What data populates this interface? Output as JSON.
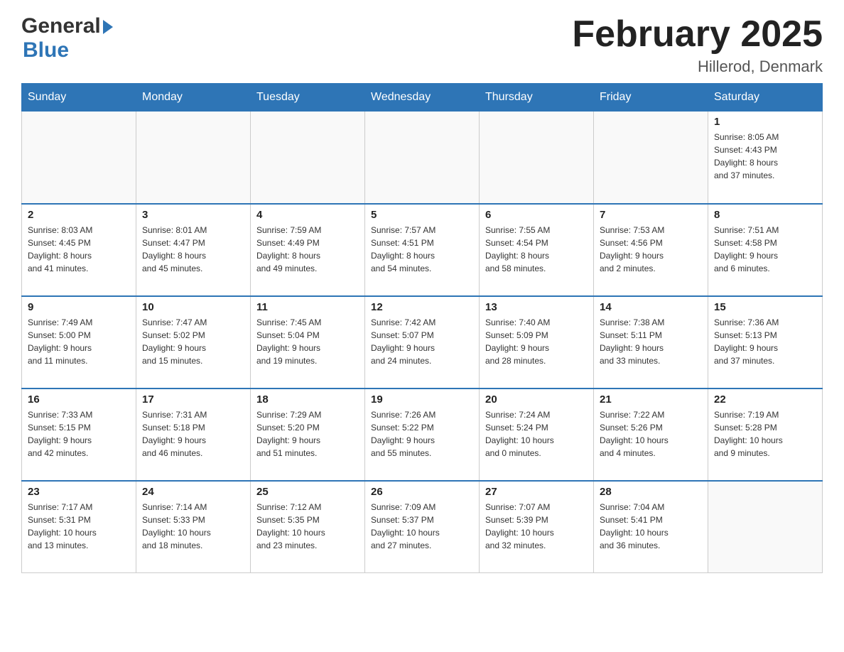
{
  "header": {
    "logo_general": "General",
    "logo_blue": "Blue",
    "title": "February 2025",
    "location": "Hillerod, Denmark"
  },
  "weekdays": [
    "Sunday",
    "Monday",
    "Tuesday",
    "Wednesday",
    "Thursday",
    "Friday",
    "Saturday"
  ],
  "weeks": [
    [
      {
        "day": "",
        "info": ""
      },
      {
        "day": "",
        "info": ""
      },
      {
        "day": "",
        "info": ""
      },
      {
        "day": "",
        "info": ""
      },
      {
        "day": "",
        "info": ""
      },
      {
        "day": "",
        "info": ""
      },
      {
        "day": "1",
        "info": "Sunrise: 8:05 AM\nSunset: 4:43 PM\nDaylight: 8 hours\nand 37 minutes."
      }
    ],
    [
      {
        "day": "2",
        "info": "Sunrise: 8:03 AM\nSunset: 4:45 PM\nDaylight: 8 hours\nand 41 minutes."
      },
      {
        "day": "3",
        "info": "Sunrise: 8:01 AM\nSunset: 4:47 PM\nDaylight: 8 hours\nand 45 minutes."
      },
      {
        "day": "4",
        "info": "Sunrise: 7:59 AM\nSunset: 4:49 PM\nDaylight: 8 hours\nand 49 minutes."
      },
      {
        "day": "5",
        "info": "Sunrise: 7:57 AM\nSunset: 4:51 PM\nDaylight: 8 hours\nand 54 minutes."
      },
      {
        "day": "6",
        "info": "Sunrise: 7:55 AM\nSunset: 4:54 PM\nDaylight: 8 hours\nand 58 minutes."
      },
      {
        "day": "7",
        "info": "Sunrise: 7:53 AM\nSunset: 4:56 PM\nDaylight: 9 hours\nand 2 minutes."
      },
      {
        "day": "8",
        "info": "Sunrise: 7:51 AM\nSunset: 4:58 PM\nDaylight: 9 hours\nand 6 minutes."
      }
    ],
    [
      {
        "day": "9",
        "info": "Sunrise: 7:49 AM\nSunset: 5:00 PM\nDaylight: 9 hours\nand 11 minutes."
      },
      {
        "day": "10",
        "info": "Sunrise: 7:47 AM\nSunset: 5:02 PM\nDaylight: 9 hours\nand 15 minutes."
      },
      {
        "day": "11",
        "info": "Sunrise: 7:45 AM\nSunset: 5:04 PM\nDaylight: 9 hours\nand 19 minutes."
      },
      {
        "day": "12",
        "info": "Sunrise: 7:42 AM\nSunset: 5:07 PM\nDaylight: 9 hours\nand 24 minutes."
      },
      {
        "day": "13",
        "info": "Sunrise: 7:40 AM\nSunset: 5:09 PM\nDaylight: 9 hours\nand 28 minutes."
      },
      {
        "day": "14",
        "info": "Sunrise: 7:38 AM\nSunset: 5:11 PM\nDaylight: 9 hours\nand 33 minutes."
      },
      {
        "day": "15",
        "info": "Sunrise: 7:36 AM\nSunset: 5:13 PM\nDaylight: 9 hours\nand 37 minutes."
      }
    ],
    [
      {
        "day": "16",
        "info": "Sunrise: 7:33 AM\nSunset: 5:15 PM\nDaylight: 9 hours\nand 42 minutes."
      },
      {
        "day": "17",
        "info": "Sunrise: 7:31 AM\nSunset: 5:18 PM\nDaylight: 9 hours\nand 46 minutes."
      },
      {
        "day": "18",
        "info": "Sunrise: 7:29 AM\nSunset: 5:20 PM\nDaylight: 9 hours\nand 51 minutes."
      },
      {
        "day": "19",
        "info": "Sunrise: 7:26 AM\nSunset: 5:22 PM\nDaylight: 9 hours\nand 55 minutes."
      },
      {
        "day": "20",
        "info": "Sunrise: 7:24 AM\nSunset: 5:24 PM\nDaylight: 10 hours\nand 0 minutes."
      },
      {
        "day": "21",
        "info": "Sunrise: 7:22 AM\nSunset: 5:26 PM\nDaylight: 10 hours\nand 4 minutes."
      },
      {
        "day": "22",
        "info": "Sunrise: 7:19 AM\nSunset: 5:28 PM\nDaylight: 10 hours\nand 9 minutes."
      }
    ],
    [
      {
        "day": "23",
        "info": "Sunrise: 7:17 AM\nSunset: 5:31 PM\nDaylight: 10 hours\nand 13 minutes."
      },
      {
        "day": "24",
        "info": "Sunrise: 7:14 AM\nSunset: 5:33 PM\nDaylight: 10 hours\nand 18 minutes."
      },
      {
        "day": "25",
        "info": "Sunrise: 7:12 AM\nSunset: 5:35 PM\nDaylight: 10 hours\nand 23 minutes."
      },
      {
        "day": "26",
        "info": "Sunrise: 7:09 AM\nSunset: 5:37 PM\nDaylight: 10 hours\nand 27 minutes."
      },
      {
        "day": "27",
        "info": "Sunrise: 7:07 AM\nSunset: 5:39 PM\nDaylight: 10 hours\nand 32 minutes."
      },
      {
        "day": "28",
        "info": "Sunrise: 7:04 AM\nSunset: 5:41 PM\nDaylight: 10 hours\nand 36 minutes."
      },
      {
        "day": "",
        "info": ""
      }
    ]
  ]
}
